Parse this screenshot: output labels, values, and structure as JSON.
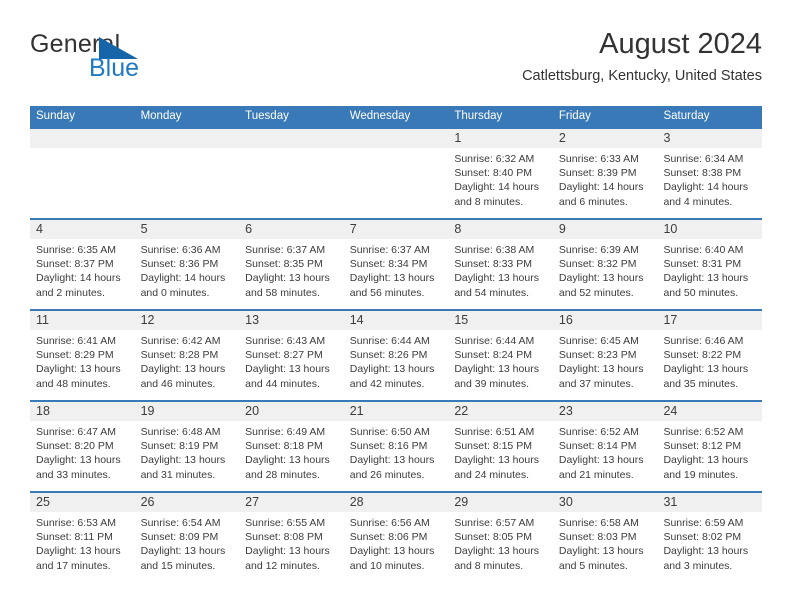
{
  "brand": {
    "name_top": "General",
    "name_bottom": "Blue",
    "flag_icon": "blue-triangle-flag",
    "accent_color": "#1f7ac4"
  },
  "header": {
    "title": "August 2024",
    "subtitle": "Catlettsburg, Kentucky, United States"
  },
  "colors": {
    "header_blue": "#3a79b8",
    "daynum_band": "#f0f0f0",
    "cell_background": "#ffffff",
    "text": "#3c3c3c"
  },
  "weekdays": [
    "Sunday",
    "Monday",
    "Tuesday",
    "Wednesday",
    "Thursday",
    "Friday",
    "Saturday"
  ],
  "labels": {
    "sunrise": "Sunrise:",
    "sunset": "Sunset:",
    "daylight": "Daylight:"
  },
  "weeks": [
    [
      {
        "day": "",
        "sunrise": "",
        "sunset": "",
        "daylight": "",
        "empty": true
      },
      {
        "day": "",
        "sunrise": "",
        "sunset": "",
        "daylight": "",
        "empty": true
      },
      {
        "day": "",
        "sunrise": "",
        "sunset": "",
        "daylight": "",
        "empty": true
      },
      {
        "day": "",
        "sunrise": "",
        "sunset": "",
        "daylight": "",
        "empty": true
      },
      {
        "day": "1",
        "sunrise": "Sunrise: 6:32 AM",
        "sunset": "Sunset: 8:40 PM",
        "daylight": "Daylight: 14 hours and 8 minutes."
      },
      {
        "day": "2",
        "sunrise": "Sunrise: 6:33 AM",
        "sunset": "Sunset: 8:39 PM",
        "daylight": "Daylight: 14 hours and 6 minutes."
      },
      {
        "day": "3",
        "sunrise": "Sunrise: 6:34 AM",
        "sunset": "Sunset: 8:38 PM",
        "daylight": "Daylight: 14 hours and 4 minutes."
      }
    ],
    [
      {
        "day": "4",
        "sunrise": "Sunrise: 6:35 AM",
        "sunset": "Sunset: 8:37 PM",
        "daylight": "Daylight: 14 hours and 2 minutes."
      },
      {
        "day": "5",
        "sunrise": "Sunrise: 6:36 AM",
        "sunset": "Sunset: 8:36 PM",
        "daylight": "Daylight: 14 hours and 0 minutes."
      },
      {
        "day": "6",
        "sunrise": "Sunrise: 6:37 AM",
        "sunset": "Sunset: 8:35 PM",
        "daylight": "Daylight: 13 hours and 58 minutes."
      },
      {
        "day": "7",
        "sunrise": "Sunrise: 6:37 AM",
        "sunset": "Sunset: 8:34 PM",
        "daylight": "Daylight: 13 hours and 56 minutes."
      },
      {
        "day": "8",
        "sunrise": "Sunrise: 6:38 AM",
        "sunset": "Sunset: 8:33 PM",
        "daylight": "Daylight: 13 hours and 54 minutes."
      },
      {
        "day": "9",
        "sunrise": "Sunrise: 6:39 AM",
        "sunset": "Sunset: 8:32 PM",
        "daylight": "Daylight: 13 hours and 52 minutes."
      },
      {
        "day": "10",
        "sunrise": "Sunrise: 6:40 AM",
        "sunset": "Sunset: 8:31 PM",
        "daylight": "Daylight: 13 hours and 50 minutes."
      }
    ],
    [
      {
        "day": "11",
        "sunrise": "Sunrise: 6:41 AM",
        "sunset": "Sunset: 8:29 PM",
        "daylight": "Daylight: 13 hours and 48 minutes."
      },
      {
        "day": "12",
        "sunrise": "Sunrise: 6:42 AM",
        "sunset": "Sunset: 8:28 PM",
        "daylight": "Daylight: 13 hours and 46 minutes."
      },
      {
        "day": "13",
        "sunrise": "Sunrise: 6:43 AM",
        "sunset": "Sunset: 8:27 PM",
        "daylight": "Daylight: 13 hours and 44 minutes."
      },
      {
        "day": "14",
        "sunrise": "Sunrise: 6:44 AM",
        "sunset": "Sunset: 8:26 PM",
        "daylight": "Daylight: 13 hours and 42 minutes."
      },
      {
        "day": "15",
        "sunrise": "Sunrise: 6:44 AM",
        "sunset": "Sunset: 8:24 PM",
        "daylight": "Daylight: 13 hours and 39 minutes."
      },
      {
        "day": "16",
        "sunrise": "Sunrise: 6:45 AM",
        "sunset": "Sunset: 8:23 PM",
        "daylight": "Daylight: 13 hours and 37 minutes."
      },
      {
        "day": "17",
        "sunrise": "Sunrise: 6:46 AM",
        "sunset": "Sunset: 8:22 PM",
        "daylight": "Daylight: 13 hours and 35 minutes."
      }
    ],
    [
      {
        "day": "18",
        "sunrise": "Sunrise: 6:47 AM",
        "sunset": "Sunset: 8:20 PM",
        "daylight": "Daylight: 13 hours and 33 minutes."
      },
      {
        "day": "19",
        "sunrise": "Sunrise: 6:48 AM",
        "sunset": "Sunset: 8:19 PM",
        "daylight": "Daylight: 13 hours and 31 minutes."
      },
      {
        "day": "20",
        "sunrise": "Sunrise: 6:49 AM",
        "sunset": "Sunset: 8:18 PM",
        "daylight": "Daylight: 13 hours and 28 minutes."
      },
      {
        "day": "21",
        "sunrise": "Sunrise: 6:50 AM",
        "sunset": "Sunset: 8:16 PM",
        "daylight": "Daylight: 13 hours and 26 minutes."
      },
      {
        "day": "22",
        "sunrise": "Sunrise: 6:51 AM",
        "sunset": "Sunset: 8:15 PM",
        "daylight": "Daylight: 13 hours and 24 minutes."
      },
      {
        "day": "23",
        "sunrise": "Sunrise: 6:52 AM",
        "sunset": "Sunset: 8:14 PM",
        "daylight": "Daylight: 13 hours and 21 minutes."
      },
      {
        "day": "24",
        "sunrise": "Sunrise: 6:52 AM",
        "sunset": "Sunset: 8:12 PM",
        "daylight": "Daylight: 13 hours and 19 minutes."
      }
    ],
    [
      {
        "day": "25",
        "sunrise": "Sunrise: 6:53 AM",
        "sunset": "Sunset: 8:11 PM",
        "daylight": "Daylight: 13 hours and 17 minutes."
      },
      {
        "day": "26",
        "sunrise": "Sunrise: 6:54 AM",
        "sunset": "Sunset: 8:09 PM",
        "daylight": "Daylight: 13 hours and 15 minutes."
      },
      {
        "day": "27",
        "sunrise": "Sunrise: 6:55 AM",
        "sunset": "Sunset: 8:08 PM",
        "daylight": "Daylight: 13 hours and 12 minutes."
      },
      {
        "day": "28",
        "sunrise": "Sunrise: 6:56 AM",
        "sunset": "Sunset: 8:06 PM",
        "daylight": "Daylight: 13 hours and 10 minutes."
      },
      {
        "day": "29",
        "sunrise": "Sunrise: 6:57 AM",
        "sunset": "Sunset: 8:05 PM",
        "daylight": "Daylight: 13 hours and 8 minutes."
      },
      {
        "day": "30",
        "sunrise": "Sunrise: 6:58 AM",
        "sunset": "Sunset: 8:03 PM",
        "daylight": "Daylight: 13 hours and 5 minutes."
      },
      {
        "day": "31",
        "sunrise": "Sunrise: 6:59 AM",
        "sunset": "Sunset: 8:02 PM",
        "daylight": "Daylight: 13 hours and 3 minutes."
      }
    ]
  ]
}
